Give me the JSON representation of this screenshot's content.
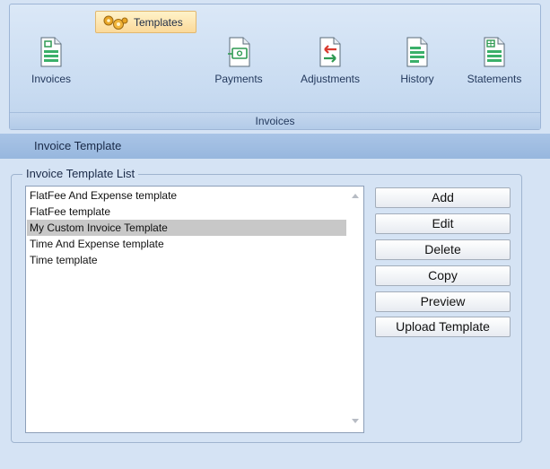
{
  "ribbon": {
    "templates_label": "Templates",
    "buttons": [
      {
        "label": "Invoices"
      },
      {
        "label": "Payments"
      },
      {
        "label": "Adjustments"
      },
      {
        "label": "History"
      },
      {
        "label": "Statements"
      }
    ],
    "group_label": "Invoices"
  },
  "section_title": "Invoice Template",
  "template_list": {
    "legend": "Invoice Template List",
    "items": [
      "FlatFee And Expense template",
      "FlatFee template",
      "My Custom Invoice Template",
      "Time And Expense template",
      "Time template"
    ],
    "selected_item": "My Custom Invoice Template"
  },
  "actions": {
    "add": "Add",
    "edit": "Edit",
    "delete": "Delete",
    "copy": "Copy",
    "preview": "Preview",
    "upload": "Upload Template"
  },
  "colors": {
    "background": "#d5e3f4",
    "section_bar": "#a9c4e6",
    "selected_row": "#c8c8c8",
    "templates_highlight": "#fbd99a"
  }
}
